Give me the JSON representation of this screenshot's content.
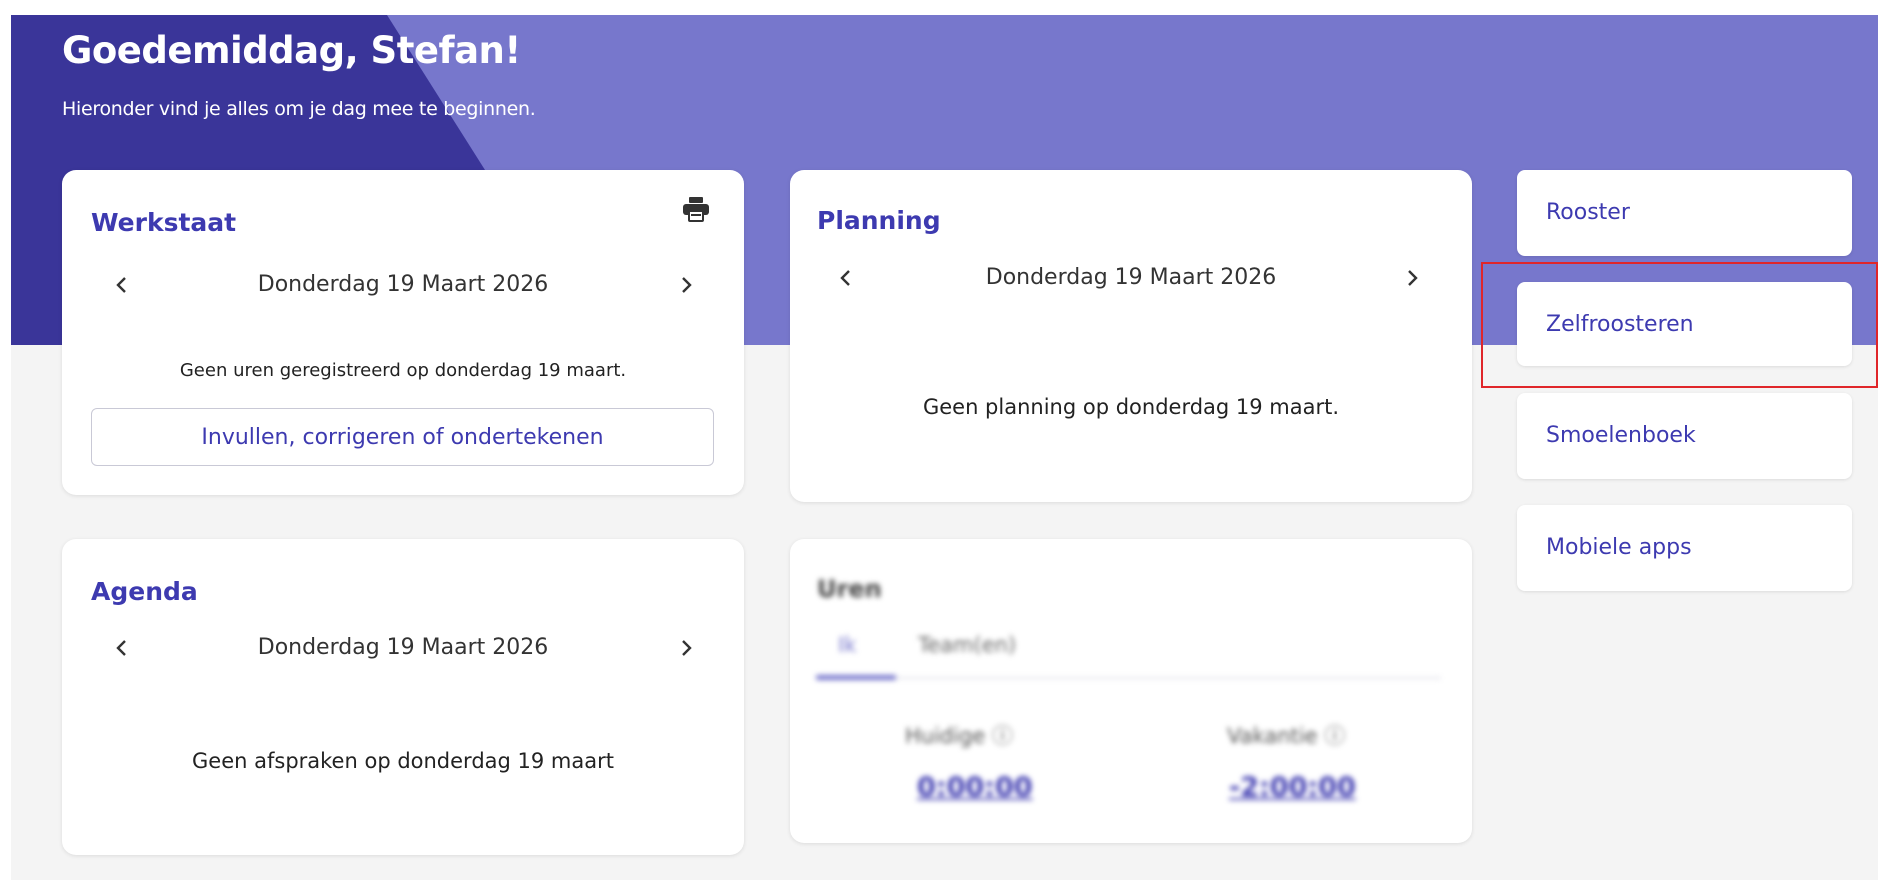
{
  "header": {
    "greeting": "Goedemiddag, Stefan!",
    "subtitle": "Hieronder vind je alles om je dag mee te beginnen."
  },
  "werkstaat": {
    "title": "Werkstaat",
    "date": "Donderdag 19 Maart 2026",
    "empty_message": "Geen uren geregistreerd op donderdag 19 maart.",
    "action_label": "Invullen, corrigeren of ondertekenen"
  },
  "planning": {
    "title": "Planning",
    "date": "Donderdag 19 Maart 2026",
    "empty_message": "Geen planning op donderdag 19 maart."
  },
  "agenda": {
    "title": "Agenda",
    "date": "Donderdag 19 Maart 2026",
    "empty_message": "Geen afspraken op donderdag 19 maart"
  },
  "uren": {
    "title": "Uren",
    "tabs": [
      {
        "label": "Ik",
        "active": true
      },
      {
        "label": "Team(en)",
        "active": false
      }
    ],
    "metrics": [
      {
        "label": "Huidige ⓘ",
        "value": "0:00:00"
      },
      {
        "label": "Vakantie ⓘ",
        "value": "-2:00:00"
      }
    ]
  },
  "quick_links": [
    {
      "label": "Rooster"
    },
    {
      "label": "Zelfroosteren"
    },
    {
      "label": "Smoelenboek"
    },
    {
      "label": "Mobiele apps"
    }
  ],
  "colors": {
    "hero_dark": "#3a3599",
    "hero_light": "#7777cc",
    "accent_text": "#3d3ab0",
    "highlight": "#e0262a",
    "background": "#f4f4f4"
  }
}
